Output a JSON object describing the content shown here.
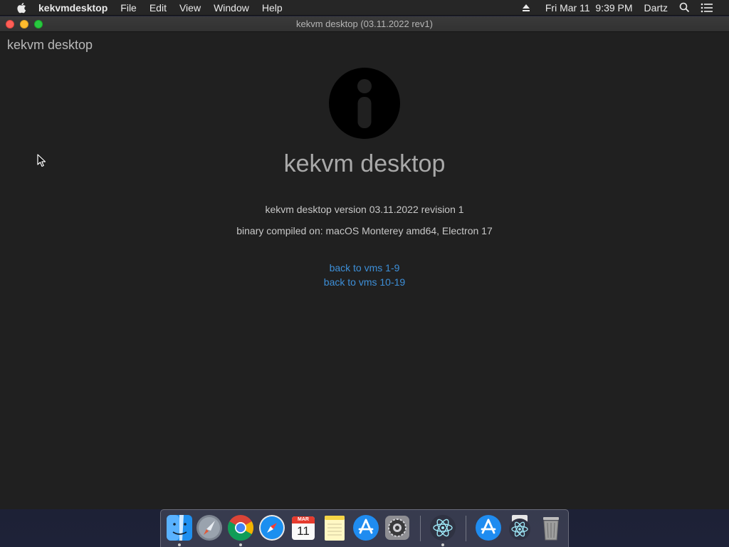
{
  "menubar": {
    "app_name": "kekvmdesktop",
    "menus": [
      "File",
      "Edit",
      "View",
      "Window",
      "Help"
    ],
    "clock": "Fri Mar 11  9:39 PM",
    "user": "Dartz"
  },
  "window": {
    "title": "kekvm desktop (03.11.2022 rev1)",
    "corner_title": "kekvm desktop",
    "heading": "kekvm desktop",
    "version_line": "kekvm desktop version 03.11.2022 revision 1",
    "compiled_line": "binary compiled on: macOS Monterey amd64, Electron 17",
    "links": [
      "back to vms 1-9",
      "back to vms 10-19"
    ],
    "link_color": "#3d8fd8"
  },
  "dock": {
    "calendar_month": "MAR",
    "calendar_day": "11",
    "items": [
      {
        "name": "finder-icon",
        "running": true
      },
      {
        "name": "launchpad-icon",
        "running": false
      },
      {
        "name": "chrome-icon",
        "running": true
      },
      {
        "name": "safari-icon",
        "running": false
      },
      {
        "name": "calendar-icon",
        "running": false
      },
      {
        "name": "notes-icon",
        "running": false
      },
      {
        "name": "app-store-icon",
        "running": false
      },
      {
        "name": "system-preferences-icon",
        "running": false
      },
      {
        "name": "electron-icon",
        "running": true
      },
      {
        "name": "app-store-folder-icon",
        "running": false
      },
      {
        "name": "electron-folder-icon",
        "running": false
      },
      {
        "name": "trash-icon",
        "running": false
      }
    ]
  }
}
